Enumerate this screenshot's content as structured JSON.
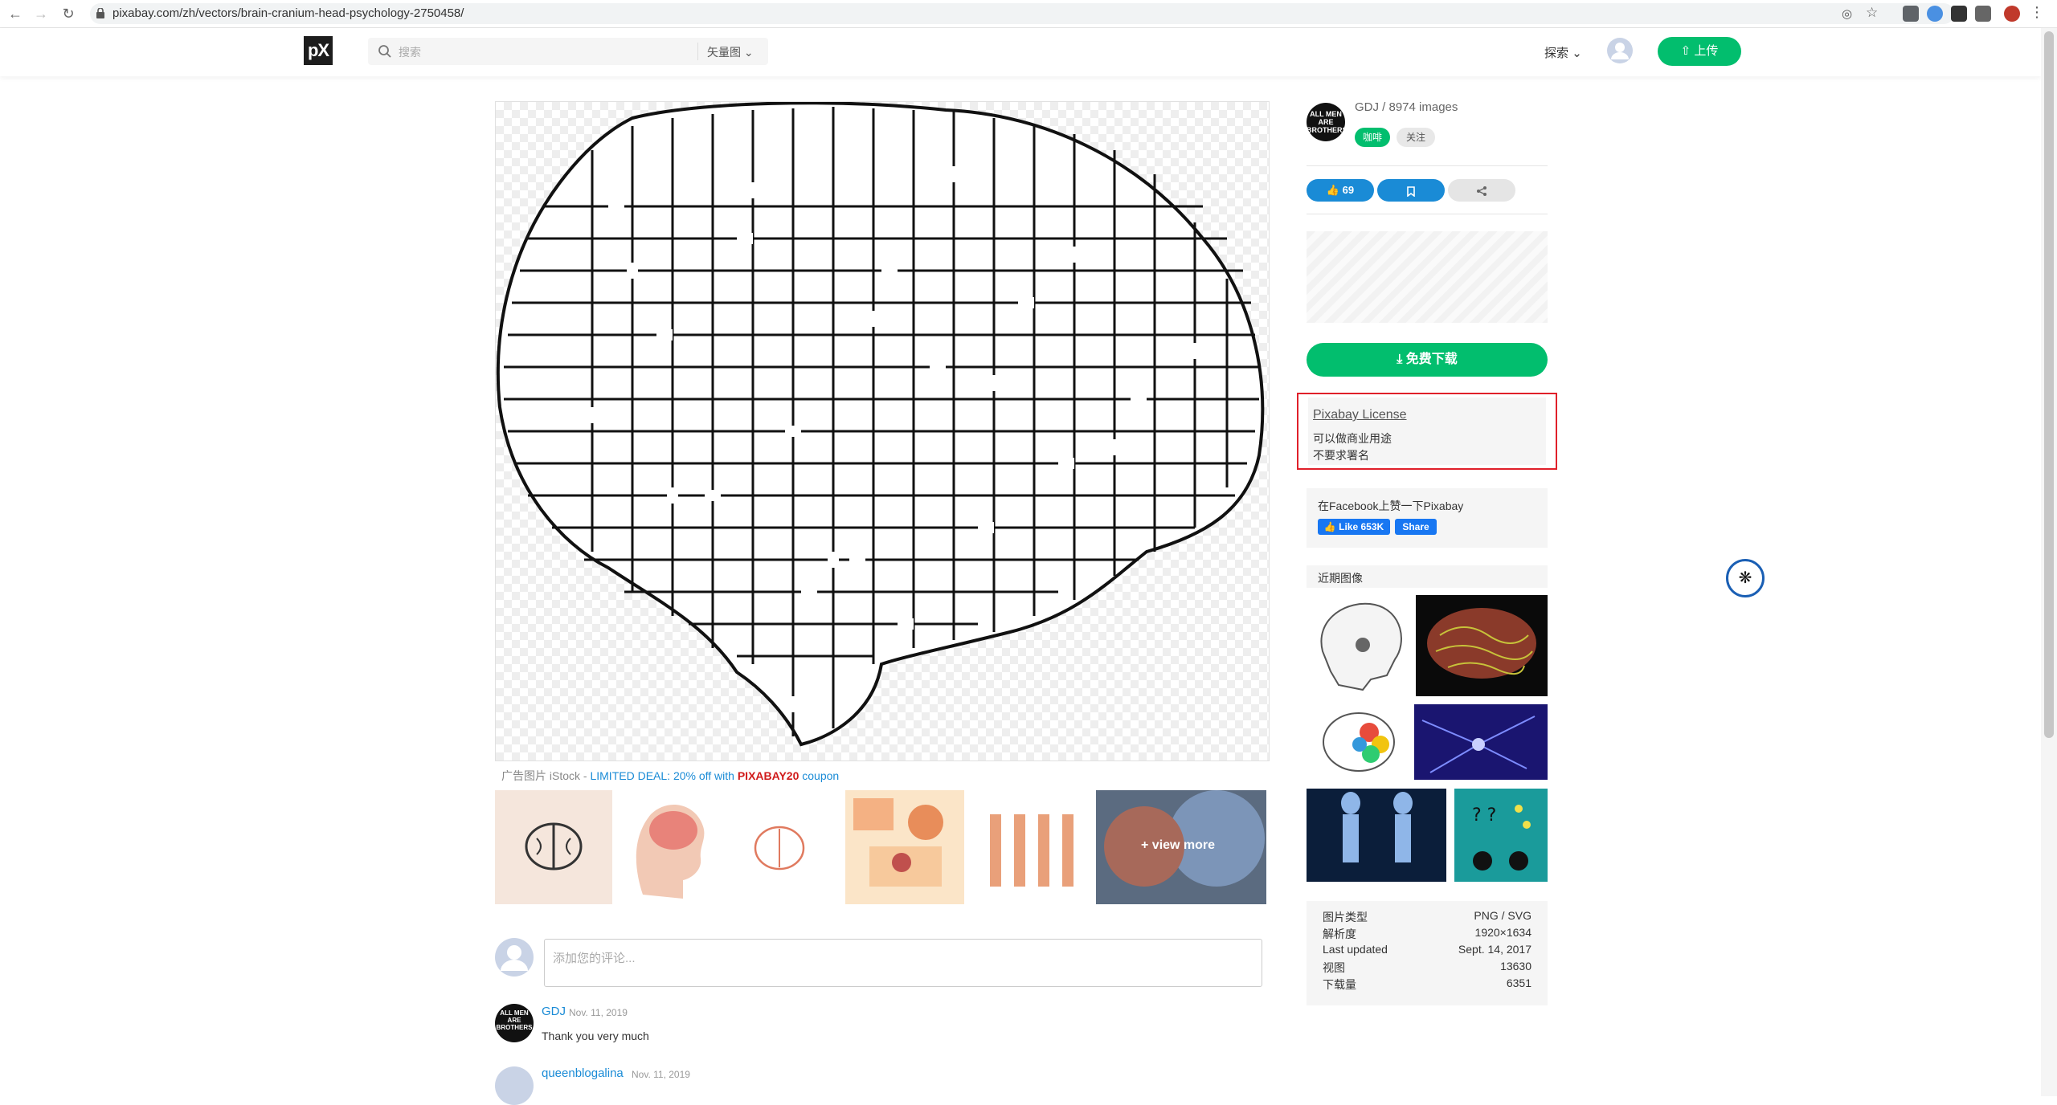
{
  "browser": {
    "url": "pixabay.com/zh/vectors/brain-cranium-head-psychology-2750458/"
  },
  "header": {
    "logo": "pX",
    "search_placeholder": "搜索",
    "search_type": "矢量图",
    "explore_label": "探索",
    "upload_label": "上传"
  },
  "ad": {
    "prefix": "广告图片 iStock - ",
    "deal": "LIMITED DEAL: 20% off with ",
    "code": "PIXABAY20",
    "suffix": " coupon",
    "view_more": "+ view more"
  },
  "comments": {
    "placeholder": "添加您的评论...",
    "items": [
      {
        "author": "GDJ",
        "date": "Nov. 11, 2019",
        "text": "Thank you very much"
      },
      {
        "author": "queenblogalina",
        "date": "Nov. 11, 2019",
        "text": ""
      }
    ]
  },
  "sidebar": {
    "author_avatar_text": "ALL MEN ARE BROTHERS",
    "author_line": "GDJ / 8974 images",
    "coffee_label": "咖啡",
    "follow_label": "关注",
    "likes": "69",
    "download_label": "免费下载",
    "license": {
      "title": "Pixabay License",
      "line1": "可以做商业用途",
      "line2": "不要求署名"
    },
    "facebook": {
      "text": "在Facebook上赞一下Pixabay",
      "like_label": "Like 653K",
      "share_label": "Share"
    },
    "recent_title": "近期图像",
    "info": [
      {
        "key": "图片类型",
        "value": "PNG / SVG"
      },
      {
        "key": "解析度",
        "value": "1920×1634"
      },
      {
        "key": "Last updated",
        "value": "Sept. 14, 2017"
      },
      {
        "key": "视图",
        "value": "13630"
      },
      {
        "key": "下载量",
        "value": "6351"
      }
    ]
  },
  "colors": {
    "brand_green": "#02be6e",
    "link_blue": "#1a8bd6",
    "license_border": "#e0202a"
  }
}
